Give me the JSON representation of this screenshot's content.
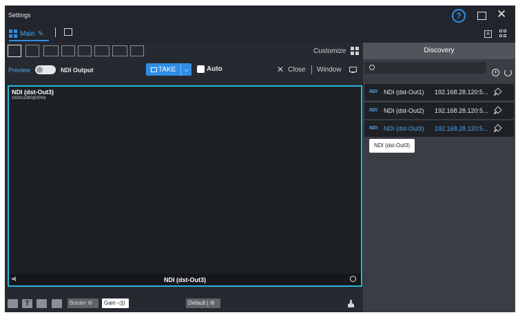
{
  "window": {
    "title": "Settings"
  },
  "tabs": {
    "main_label": "Main"
  },
  "toolbar": {
    "customize_label": "Customize"
  },
  "controls": {
    "preview_label": "Preview",
    "ndi_output_label": "NDI Output",
    "take_label": "TAKE",
    "auto_label": "Auto",
    "auto_checked": false,
    "close_label": "Close",
    "window_label": "Window",
    "preview_toggle_on": true
  },
  "preview": {
    "source_name": "NDI (dst-Out3)",
    "resolution": "1920x1080@30Hz",
    "footer_name": "NDI (dst-Out3)",
    "border_color": "#2bb6d9"
  },
  "bottom": {
    "border_label": "Border",
    "gain_label": "Gain",
    "default_label": "Default"
  },
  "discovery": {
    "title": "Discovery",
    "search_placeholder": "",
    "sources": [
      {
        "logo": "NDI",
        "name": "NDI (dst-Out1)",
        "ip": "192.168.28.120:5...",
        "active": false
      },
      {
        "logo": "NDI",
        "name": "NDI (dst-Out2)",
        "ip": "192.168.28.120:5...",
        "active": false
      },
      {
        "logo": "NDI",
        "name": "NDI (dst-Out3)",
        "ip": "192.168.28.120:5...",
        "active": true
      }
    ],
    "tooltip": "NDI (dst-Out3)"
  },
  "colors": {
    "accent": "#2e8ee6",
    "highlight": "#4fa3f0"
  }
}
